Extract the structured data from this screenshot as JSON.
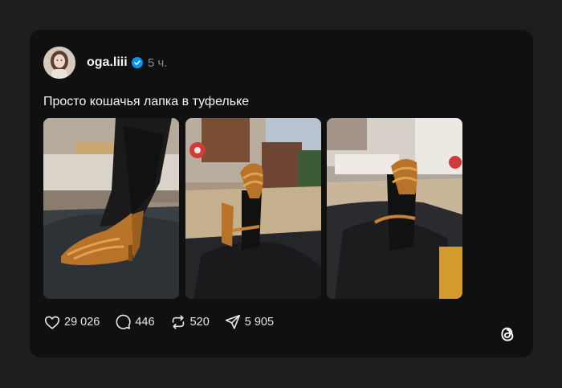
{
  "post": {
    "author": "oga.liii",
    "verified_icon": "verified-badge-icon",
    "time_ago": "5 ч.",
    "text": "Просто кошачья лапка в туфельке",
    "image_count": 3
  },
  "actions": {
    "likes": "29 026",
    "comments": "446",
    "reposts": "520",
    "shares": "5 905"
  },
  "icons": {
    "like": "heart-icon",
    "comment": "comment-bubble-icon",
    "repost": "repost-icon",
    "share": "send-icon",
    "brand": "threads-logo-icon"
  },
  "colors": {
    "page_bg": "#1e1e1e",
    "card_bg": "#101010",
    "text_primary": "#f3f5f7",
    "text_secondary": "#8a8a8a",
    "verified_blue": "#0095f6"
  }
}
